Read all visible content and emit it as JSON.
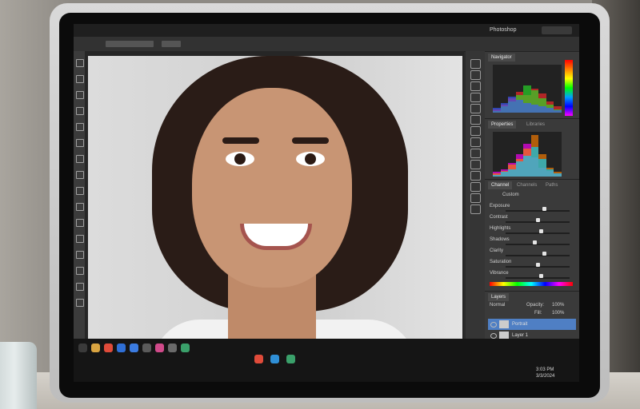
{
  "app": {
    "document_title": "Photoshop"
  },
  "panels": {
    "histogram": {
      "tabs": [
        "Navigator"
      ],
      "series": [
        {
          "color": "#ff2a2a",
          "values": [
            4,
            10,
            18,
            26,
            22,
            30,
            24,
            14,
            8
          ]
        },
        {
          "color": "#28e028",
          "values": [
            2,
            8,
            14,
            22,
            34,
            28,
            18,
            10,
            4
          ]
        },
        {
          "color": "#3a5bff",
          "values": [
            6,
            12,
            20,
            16,
            12,
            10,
            8,
            6,
            3
          ]
        }
      ]
    },
    "properties": {
      "tabs": [
        "Properties",
        "Libraries"
      ],
      "series": [
        {
          "color": "#ff00ff",
          "values": [
            6,
            10,
            18,
            30,
            44,
            26,
            12,
            8,
            4
          ]
        },
        {
          "color": "#ff7f00",
          "values": [
            4,
            8,
            16,
            24,
            38,
            56,
            30,
            12,
            6
          ]
        },
        {
          "color": "#00d0ff",
          "values": [
            2,
            6,
            10,
            20,
            28,
            40,
            24,
            10,
            4
          ]
        }
      ]
    },
    "adjustments": {
      "header_tabs": [
        "Channel",
        "Channels",
        "Paths"
      ],
      "preset_label": "Custom",
      "rows": [
        {
          "label": "Exposure",
          "level": 0.6
        },
        {
          "label": "Contrast",
          "level": 0.5
        },
        {
          "label": "Highlights",
          "level": 0.55
        },
        {
          "label": "Shadows",
          "level": 0.45
        },
        {
          "label": "Clarity",
          "level": 0.6
        },
        {
          "label": "Saturation",
          "level": 0.5
        },
        {
          "label": "Vibrance",
          "level": 0.55
        }
      ]
    },
    "layers": {
      "header_tabs": [
        "Layers"
      ],
      "blend_mode": "Normal",
      "opacity_label": "Opacity:",
      "opacity_value": "100%",
      "fill_label": "Fill:",
      "fill_value": "100%",
      "items": [
        {
          "name": "Portrait",
          "selected": true
        },
        {
          "name": "Layer 1",
          "selected": false
        }
      ]
    }
  },
  "taskbar": {
    "tray_time": "3:03 PM",
    "tray_date": "3/3/2024"
  },
  "colors": {
    "panel_bg": "#3a3a3a",
    "selection": "#4f7fc4",
    "taskbar_bg": "#151515"
  },
  "icons": {
    "tools": [
      "move-icon",
      "marquee-icon",
      "lasso-icon",
      "quick-select-icon",
      "crop-icon",
      "eyedropper-icon",
      "healing-icon",
      "brush-icon",
      "clone-icon",
      "eraser-icon",
      "gradient-icon",
      "dodge-icon",
      "pen-icon",
      "text-icon",
      "hand-icon",
      "zoom-icon"
    ],
    "taskbar": [
      "start-icon",
      "explorer-icon",
      "chrome-icon",
      "photoshop-icon",
      "mail-icon",
      "store-icon",
      "photos-icon",
      "settings-icon",
      "files-icon"
    ]
  }
}
